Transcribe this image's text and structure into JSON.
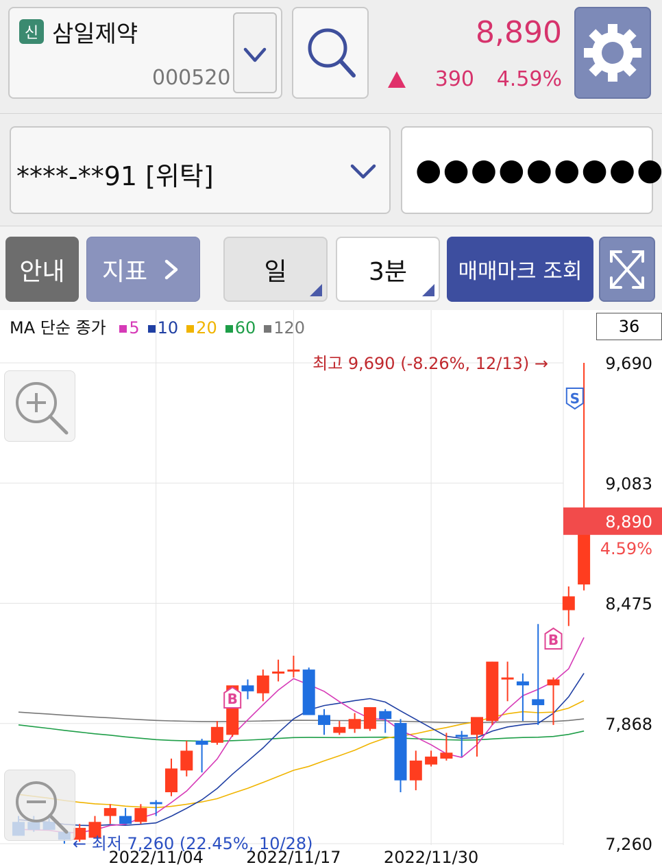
{
  "header": {
    "badge": "신",
    "stock_name": "삼일제약",
    "stock_code": "000520",
    "price": "8,890",
    "change": "390",
    "change_rate": "4.59%",
    "up_color": "#d6336c"
  },
  "account": {
    "number": "****-**91 [위탁]",
    "password_mask": "●●●●●●●●●"
  },
  "toolbar": {
    "guide_label": "안내",
    "indicator_label": "지표",
    "period_label": "일",
    "interval_label": "3분",
    "trade_mark_label": "매매마크 조회"
  },
  "legend": {
    "prefix": "MA 단순 종가",
    "items": [
      {
        "label": "5",
        "color": "#d63ab7"
      },
      {
        "label": "10",
        "color": "#1f3fa3"
      },
      {
        "label": "20",
        "color": "#f0b400"
      },
      {
        "label": "60",
        "color": "#1e9e48"
      },
      {
        "label": "120",
        "color": "#777777"
      }
    ]
  },
  "count": "36",
  "chart_data": {
    "type": "candlestick",
    "y_axis_labels": [
      "9,690",
      "9,083",
      "8,475",
      "7,868",
      "7,260"
    ],
    "ylim": [
      7260,
      9690
    ],
    "x_tick_labels": [
      "2022/11/04",
      "2022/11/17",
      "2022/11/30"
    ],
    "current_price_label": "8,890",
    "current_rate_label": "4.59%",
    "high_annotation": "최고 9,690 (-8.26%, 12/13) →",
    "low_annotation": "← 최저 7,260 (22.45%, 10/28)",
    "buy_mark": "B",
    "sell_mark": "S",
    "up_color": "#ff3d1f",
    "down_color": "#1f6fe0",
    "candles": [
      {
        "o": 7370,
        "h": 7400,
        "l": 7300,
        "c": 7300
      },
      {
        "o": 7370,
        "h": 7400,
        "l": 7320,
        "c": 7330
      },
      {
        "o": 7370,
        "h": 7390,
        "l": 7330,
        "c": 7330
      },
      {
        "o": 7320,
        "h": 7340,
        "l": 7260,
        "c": 7280
      },
      {
        "o": 7280,
        "h": 7360,
        "l": 7270,
        "c": 7340
      },
      {
        "o": 7290,
        "h": 7400,
        "l": 7290,
        "c": 7370
      },
      {
        "o": 7400,
        "h": 7460,
        "l": 7360,
        "c": 7440
      },
      {
        "o": 7400,
        "h": 7440,
        "l": 7360,
        "c": 7360
      },
      {
        "o": 7370,
        "h": 7460,
        "l": 7360,
        "c": 7440
      },
      {
        "o": 7470,
        "h": 7480,
        "l": 7400,
        "c": 7460
      },
      {
        "o": 7520,
        "h": 7690,
        "l": 7500,
        "c": 7640
      },
      {
        "o": 7630,
        "h": 7780,
        "l": 7600,
        "c": 7730
      },
      {
        "o": 7780,
        "h": 7790,
        "l": 7620,
        "c": 7760
      },
      {
        "o": 7770,
        "h": 7880,
        "l": 7760,
        "c": 7850
      },
      {
        "o": 7810,
        "h": 8040,
        "l": 7800,
        "c": 8060
      },
      {
        "o": 8060,
        "h": 8090,
        "l": 7990,
        "c": 8030
      },
      {
        "o": 8020,
        "h": 8140,
        "l": 7980,
        "c": 8110
      },
      {
        "o": 8130,
        "h": 8190,
        "l": 8080,
        "c": 8130
      },
      {
        "o": 8140,
        "h": 8210,
        "l": 8100,
        "c": 8140
      },
      {
        "o": 8140,
        "h": 8150,
        "l": 7910,
        "c": 7910
      },
      {
        "o": 7910,
        "h": 7940,
        "l": 7810,
        "c": 7860
      },
      {
        "o": 7820,
        "h": 7880,
        "l": 7810,
        "c": 7850
      },
      {
        "o": 7840,
        "h": 7920,
        "l": 7820,
        "c": 7890
      },
      {
        "o": 7840,
        "h": 7950,
        "l": 7830,
        "c": 7950
      },
      {
        "o": 7930,
        "h": 7940,
        "l": 7820,
        "c": 7890
      },
      {
        "o": 7870,
        "h": 7890,
        "l": 7520,
        "c": 7580
      },
      {
        "o": 7580,
        "h": 7730,
        "l": 7530,
        "c": 7680
      },
      {
        "o": 7660,
        "h": 7730,
        "l": 7650,
        "c": 7700
      },
      {
        "o": 7690,
        "h": 7820,
        "l": 7680,
        "c": 7720
      },
      {
        "o": 7810,
        "h": 7830,
        "l": 7700,
        "c": 7800
      },
      {
        "o": 7810,
        "h": 7870,
        "l": 7700,
        "c": 7900
      },
      {
        "o": 7880,
        "h": 8180,
        "l": 7860,
        "c": 8180
      },
      {
        "o": 8100,
        "h": 8180,
        "l": 7980,
        "c": 8100
      },
      {
        "o": 8080,
        "h": 8120,
        "l": 7880,
        "c": 8060
      },
      {
        "o": 7990,
        "h": 8370,
        "l": 7860,
        "c": 7960
      },
      {
        "o": 8060,
        "h": 8100,
        "l": 7860,
        "c": 8090
      },
      {
        "o": 8440,
        "h": 8560,
        "l": 8360,
        "c": 8510
      },
      {
        "o": 8570,
        "h": 9690,
        "l": 8540,
        "c": 8890
      }
    ]
  }
}
